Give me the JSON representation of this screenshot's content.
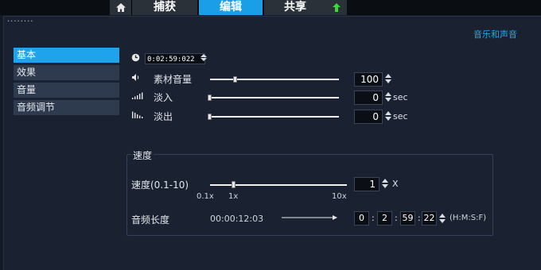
{
  "tabs": {
    "home_icon": "home-icon",
    "capture": "捕获",
    "edit": "编辑",
    "share": "共享",
    "upload_icon": "upload-arrow-icon"
  },
  "panel": {
    "grip": "········",
    "title": "音乐和声音"
  },
  "sidebar": {
    "items": [
      {
        "label": "基本",
        "active": true
      },
      {
        "label": "效果",
        "active": false
      },
      {
        "label": "音量",
        "active": false
      },
      {
        "label": "音频调节",
        "active": false
      }
    ]
  },
  "basic": {
    "duration_timecode": "0:02:59:022",
    "clip_volume_label": "素材音量",
    "clip_volume_value": "100",
    "fade_in_label": "淡入",
    "fade_in_value": "0",
    "fade_in_unit": "sec",
    "fade_out_label": "淡出",
    "fade_out_value": "0",
    "fade_out_unit": "sec"
  },
  "speed": {
    "group_title": "速度",
    "speed_label": "速度(0.1-10)",
    "speed_value": "1",
    "speed_unit": "X",
    "tick_min": "0.1x",
    "tick_mid": "1x",
    "tick_max": "10x",
    "duration_label": "音频长度",
    "original_duration": "00:00:12:03",
    "duration_h": "0",
    "duration_m": "2",
    "duration_s": "59",
    "duration_f": "22",
    "duration_format": "(H:M:S:F)"
  },
  "colors": {
    "accent": "#1fa4ec",
    "panel_bg": "#1a2130",
    "sidebar_item": "#2e3a4e"
  }
}
